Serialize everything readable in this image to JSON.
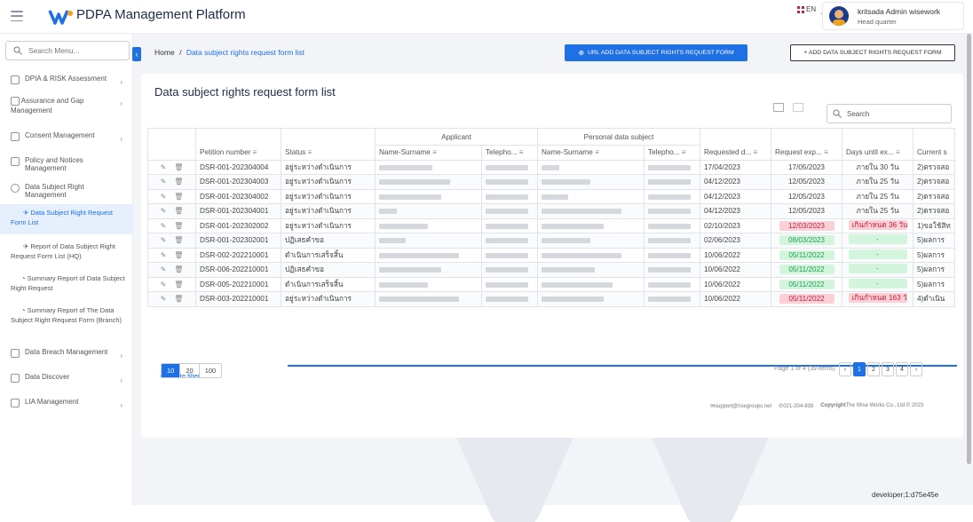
{
  "header": {
    "app_title": "PDPA Management Platform",
    "language": "EN",
    "user_name": "kritsada Admin wisework",
    "user_role": "Head quarter"
  },
  "sidebar": {
    "search_placeholder": "Search Menu...",
    "items": [
      {
        "label": "DPIA & RISK Assessment",
        "icon": "dpia-icon"
      },
      {
        "label": "Assurance and Gap Management",
        "icon": "assurance-icon"
      },
      {
        "label": "Consent Management",
        "icon": "consent-icon"
      },
      {
        "label": "Policy and Notices Management",
        "icon": "policy-icon"
      },
      {
        "label": "Data Subject Right Management",
        "icon": "dsr-icon"
      },
      {
        "label": "Data Breach Management",
        "icon": "breach-icon"
      },
      {
        "label": "Data Discover",
        "icon": "discover-icon"
      },
      {
        "label": "LIA Management",
        "icon": "lia-icon"
      }
    ],
    "subitems": [
      {
        "label": "Data Subject Right Request Form List",
        "active": true
      },
      {
        "label": "Report of Data Subject Right Request Form List (HQ)"
      },
      {
        "label": "Summary Report of Data Subject Right Request"
      },
      {
        "label": "Summary Report of The Data Subject Right Request Form (Branch)"
      }
    ]
  },
  "breadcrumb": {
    "home": "Home",
    "sep": "/",
    "current": "Data subject rights request form list"
  },
  "buttons": {
    "url_add": "URL ADD DATA SUBJECT RIGHTS REQUEST FORM",
    "add": "+  ADD DATA SUBJECT RIGHTS REQUEST FORM"
  },
  "page_title": "Data subject rights request form list",
  "table_search_placeholder": "Search",
  "table": {
    "group_applicant": "Applicant",
    "group_subject": "Personal data subject",
    "columns": {
      "petition": "Petition number",
      "status": "Status",
      "app_name": "Name-Surname",
      "app_tel": "Telepho...",
      "sub_name": "Name-Surname",
      "sub_tel": "Telepho...",
      "requested": "Requested d...",
      "expire": "Request exp...",
      "days": "Days until ex...",
      "current": "Current s"
    },
    "rows": [
      {
        "petition": "DSR-001-202304004",
        "status": "อยู่ระหว่างดำเนินการ",
        "requested": "17/04/2023",
        "expire": "17/05/2023",
        "expire_style": "plain",
        "days": "ภายใน 30 วัน",
        "days_style": "plain",
        "current": "2)ตรวจสอ"
      },
      {
        "petition": "DSR-001-202304003",
        "status": "อยู่ระหว่างดำเนินการ",
        "requested": "04/12/2023",
        "expire": "12/05/2023",
        "expire_style": "plain",
        "days": "ภายใน 25 วัน",
        "days_style": "plain",
        "current": "2)ตรวจสอ"
      },
      {
        "petition": "DSR-001-202304002",
        "status": "อยู่ระหว่างดำเนินการ",
        "requested": "04/12/2023",
        "expire": "12/05/2023",
        "expire_style": "plain",
        "days": "ภายใน 25 วัน",
        "days_style": "plain",
        "current": "2)ตรวจสอ"
      },
      {
        "petition": "DSR-001-202304001",
        "status": "อยู่ระหว่างดำเนินการ",
        "requested": "04/12/2023",
        "expire": "12/05/2023",
        "expire_style": "plain",
        "days": "ภายใน 25 วัน",
        "days_style": "plain",
        "current": "2)ตรวจสอ"
      },
      {
        "petition": "DSR-001-202302002",
        "status": "อยู่ระหว่างดำเนินการ",
        "requested": "02/10/2023",
        "expire": "12/03/2023",
        "expire_style": "red",
        "days": "เกินกำหนด 36 วัน",
        "days_style": "red",
        "current": "1)ขอใช้สิท"
      },
      {
        "petition": "DSR-001-202302001",
        "status": "ปฏิเสธคำขอ",
        "requested": "02/06/2023",
        "expire": "08/03/2023",
        "expire_style": "green",
        "days": "-",
        "days_style": "green",
        "current": "5)ผลการ"
      },
      {
        "petition": "DSR-002-202210001",
        "status": "ดำเนินการเสร็จสิ้น",
        "requested": "10/06/2022",
        "expire": "05/11/2022",
        "expire_style": "green",
        "days": "-",
        "days_style": "green",
        "current": "5)ผลการ"
      },
      {
        "petition": "DSR-006-202210001",
        "status": "ปฏิเสธคำขอ",
        "requested": "10/06/2022",
        "expire": "05/11/2022",
        "expire_style": "green",
        "days": "-",
        "days_style": "green",
        "current": "5)ผลการ"
      },
      {
        "petition": "DSR-005-202210001",
        "status": "ดำเนินการเสร็จสิ้น",
        "requested": "10/06/2022",
        "expire": "05/11/2022",
        "expire_style": "green",
        "days": "-",
        "days_style": "green",
        "current": "5)ผลการ"
      },
      {
        "petition": "DSR-003-202210001",
        "status": "อยู่ระหว่างดำเนินการ",
        "requested": "10/06/2022",
        "expire": "05/11/2022",
        "expire_style": "red",
        "days": "เกินกำหนด 163 วัน",
        "days_style": "red",
        "current": "4)ดำเนิน"
      }
    ]
  },
  "create_filter": "Create filter",
  "page_sizes": [
    "10",
    "20",
    "100"
  ],
  "page_size_selected": "10",
  "page_info": "Page 1 of 4 (39 items)",
  "pages": [
    "1",
    "2",
    "3",
    "4"
  ],
  "current_page": "1",
  "footer": {
    "email": "support@risegroups.net",
    "phone": "021-204-939",
    "copyright_label": "Copyright",
    "copyright_text": "The Wise Works Co., Ltd.© 2023"
  },
  "dev_tag": "developer;1:d75e45e",
  "colors": {
    "primary": "#1f6fe5",
    "danger_bg": "#fbd0d6",
    "success_bg": "#d3f5de"
  }
}
